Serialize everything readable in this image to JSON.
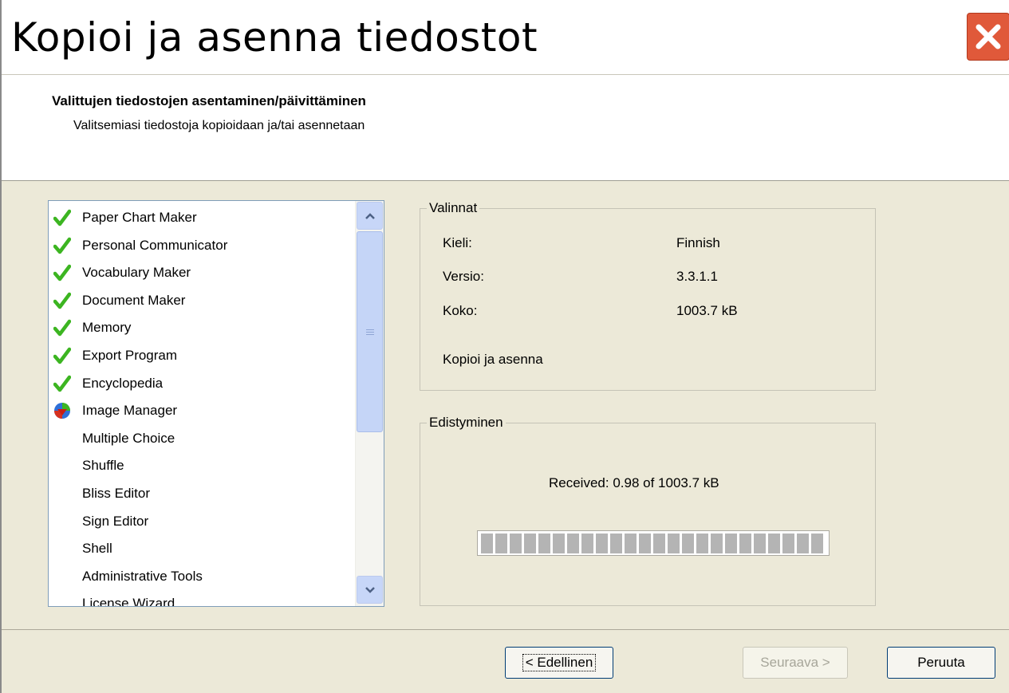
{
  "window": {
    "title": "Kopioi ja asenna tiedostot"
  },
  "header": {
    "title": "Valittujen tiedostojen asentaminen/päivittäminen",
    "subtitle": "Valitsemiasi tiedostoja kopioidaan ja/tai asennetaan"
  },
  "list": {
    "items": [
      {
        "label": "Paper Chart Maker",
        "status": "check-icon"
      },
      {
        "label": "Personal Communicator",
        "status": "check-icon"
      },
      {
        "label": "Vocabulary Maker",
        "status": "check-icon"
      },
      {
        "label": "Document Maker",
        "status": "check-icon"
      },
      {
        "label": "Memory",
        "status": "check-icon"
      },
      {
        "label": "Export Program",
        "status": "check-icon"
      },
      {
        "label": "Encyclopedia",
        "status": "check-icon"
      },
      {
        "label": "Image Manager",
        "status": "installing-globe-icon"
      },
      {
        "label": "Multiple Choice",
        "status": ""
      },
      {
        "label": "Shuffle",
        "status": ""
      },
      {
        "label": "Bliss Editor",
        "status": ""
      },
      {
        "label": "Sign Editor",
        "status": ""
      },
      {
        "label": "Shell",
        "status": ""
      },
      {
        "label": "Administrative Tools",
        "status": ""
      },
      {
        "label": "License Wizard",
        "status": ""
      }
    ]
  },
  "selections": {
    "legend": "Valinnat",
    "language_label": "Kieli:",
    "language_value": "Finnish",
    "version_label": "Versio:",
    "version_value": "3.3.1.1",
    "size_label": "Koko:",
    "size_value": "1003.7 kB",
    "action": "Kopioi ja asenna"
  },
  "progress": {
    "legend": "Edistyminen",
    "status_text": "Received: 0.98 of 1003.7 kB",
    "segments_total": 24
  },
  "buttons": {
    "back": "< Edellinen",
    "next": "Seuraava >",
    "cancel": "Peruuta"
  },
  "colors": {
    "check": "#3cb521",
    "close_button": "#e0593a",
    "dialog_bg": "#ece9d8"
  }
}
